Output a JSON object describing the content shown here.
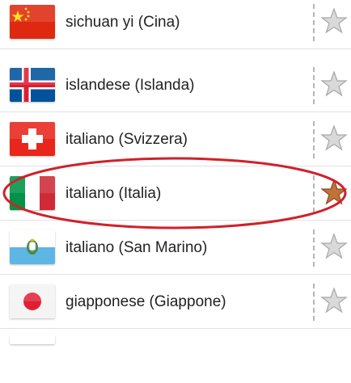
{
  "languages": [
    {
      "label": "sichuan yi (Cina)",
      "flag": "china-flag-icon",
      "favorite": false
    },
    {
      "label": "islandese (Islanda)",
      "flag": "iceland-flag-icon",
      "favorite": false
    },
    {
      "label": "italiano (Svizzera)",
      "flag": "switzerland-flag-icon",
      "favorite": false
    },
    {
      "label": "italiano (Italia)",
      "flag": "italy-flag-icon",
      "favorite": true
    },
    {
      "label": "italiano (San Marino)",
      "flag": "san-marino-flag-icon",
      "favorite": false
    },
    {
      "label": "giapponese (Giappone)",
      "flag": "japan-flag-icon",
      "favorite": false
    }
  ],
  "colors": {
    "star_inactive": "#c8c8c8",
    "star_active": "#c0723a",
    "highlight_ellipse": "#d0212a",
    "separator": "#b5b5b5"
  }
}
